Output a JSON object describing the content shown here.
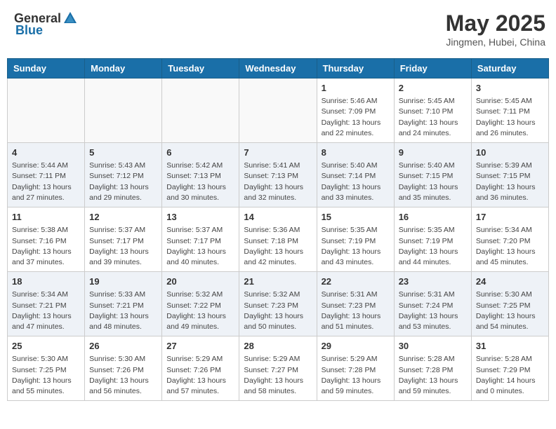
{
  "header": {
    "logo_general": "General",
    "logo_blue": "Blue",
    "month_year": "May 2025",
    "location": "Jingmen, Hubei, China"
  },
  "days_of_week": [
    "Sunday",
    "Monday",
    "Tuesday",
    "Wednesday",
    "Thursday",
    "Friday",
    "Saturday"
  ],
  "weeks": [
    [
      {
        "day": "",
        "info": ""
      },
      {
        "day": "",
        "info": ""
      },
      {
        "day": "",
        "info": ""
      },
      {
        "day": "",
        "info": ""
      },
      {
        "day": "1",
        "info": "Sunrise: 5:46 AM\nSunset: 7:09 PM\nDaylight: 13 hours\nand 22 minutes."
      },
      {
        "day": "2",
        "info": "Sunrise: 5:45 AM\nSunset: 7:10 PM\nDaylight: 13 hours\nand 24 minutes."
      },
      {
        "day": "3",
        "info": "Sunrise: 5:45 AM\nSunset: 7:11 PM\nDaylight: 13 hours\nand 26 minutes."
      }
    ],
    [
      {
        "day": "4",
        "info": "Sunrise: 5:44 AM\nSunset: 7:11 PM\nDaylight: 13 hours\nand 27 minutes."
      },
      {
        "day": "5",
        "info": "Sunrise: 5:43 AM\nSunset: 7:12 PM\nDaylight: 13 hours\nand 29 minutes."
      },
      {
        "day": "6",
        "info": "Sunrise: 5:42 AM\nSunset: 7:13 PM\nDaylight: 13 hours\nand 30 minutes."
      },
      {
        "day": "7",
        "info": "Sunrise: 5:41 AM\nSunset: 7:13 PM\nDaylight: 13 hours\nand 32 minutes."
      },
      {
        "day": "8",
        "info": "Sunrise: 5:40 AM\nSunset: 7:14 PM\nDaylight: 13 hours\nand 33 minutes."
      },
      {
        "day": "9",
        "info": "Sunrise: 5:40 AM\nSunset: 7:15 PM\nDaylight: 13 hours\nand 35 minutes."
      },
      {
        "day": "10",
        "info": "Sunrise: 5:39 AM\nSunset: 7:15 PM\nDaylight: 13 hours\nand 36 minutes."
      }
    ],
    [
      {
        "day": "11",
        "info": "Sunrise: 5:38 AM\nSunset: 7:16 PM\nDaylight: 13 hours\nand 37 minutes."
      },
      {
        "day": "12",
        "info": "Sunrise: 5:37 AM\nSunset: 7:17 PM\nDaylight: 13 hours\nand 39 minutes."
      },
      {
        "day": "13",
        "info": "Sunrise: 5:37 AM\nSunset: 7:17 PM\nDaylight: 13 hours\nand 40 minutes."
      },
      {
        "day": "14",
        "info": "Sunrise: 5:36 AM\nSunset: 7:18 PM\nDaylight: 13 hours\nand 42 minutes."
      },
      {
        "day": "15",
        "info": "Sunrise: 5:35 AM\nSunset: 7:19 PM\nDaylight: 13 hours\nand 43 minutes."
      },
      {
        "day": "16",
        "info": "Sunrise: 5:35 AM\nSunset: 7:19 PM\nDaylight: 13 hours\nand 44 minutes."
      },
      {
        "day": "17",
        "info": "Sunrise: 5:34 AM\nSunset: 7:20 PM\nDaylight: 13 hours\nand 45 minutes."
      }
    ],
    [
      {
        "day": "18",
        "info": "Sunrise: 5:34 AM\nSunset: 7:21 PM\nDaylight: 13 hours\nand 47 minutes."
      },
      {
        "day": "19",
        "info": "Sunrise: 5:33 AM\nSunset: 7:21 PM\nDaylight: 13 hours\nand 48 minutes."
      },
      {
        "day": "20",
        "info": "Sunrise: 5:32 AM\nSunset: 7:22 PM\nDaylight: 13 hours\nand 49 minutes."
      },
      {
        "day": "21",
        "info": "Sunrise: 5:32 AM\nSunset: 7:23 PM\nDaylight: 13 hours\nand 50 minutes."
      },
      {
        "day": "22",
        "info": "Sunrise: 5:31 AM\nSunset: 7:23 PM\nDaylight: 13 hours\nand 51 minutes."
      },
      {
        "day": "23",
        "info": "Sunrise: 5:31 AM\nSunset: 7:24 PM\nDaylight: 13 hours\nand 53 minutes."
      },
      {
        "day": "24",
        "info": "Sunrise: 5:30 AM\nSunset: 7:25 PM\nDaylight: 13 hours\nand 54 minutes."
      }
    ],
    [
      {
        "day": "25",
        "info": "Sunrise: 5:30 AM\nSunset: 7:25 PM\nDaylight: 13 hours\nand 55 minutes."
      },
      {
        "day": "26",
        "info": "Sunrise: 5:30 AM\nSunset: 7:26 PM\nDaylight: 13 hours\nand 56 minutes."
      },
      {
        "day": "27",
        "info": "Sunrise: 5:29 AM\nSunset: 7:26 PM\nDaylight: 13 hours\nand 57 minutes."
      },
      {
        "day": "28",
        "info": "Sunrise: 5:29 AM\nSunset: 7:27 PM\nDaylight: 13 hours\nand 58 minutes."
      },
      {
        "day": "29",
        "info": "Sunrise: 5:29 AM\nSunset: 7:28 PM\nDaylight: 13 hours\nand 59 minutes."
      },
      {
        "day": "30",
        "info": "Sunrise: 5:28 AM\nSunset: 7:28 PM\nDaylight: 13 hours\nand 59 minutes."
      },
      {
        "day": "31",
        "info": "Sunrise: 5:28 AM\nSunset: 7:29 PM\nDaylight: 14 hours\nand 0 minutes."
      }
    ]
  ]
}
